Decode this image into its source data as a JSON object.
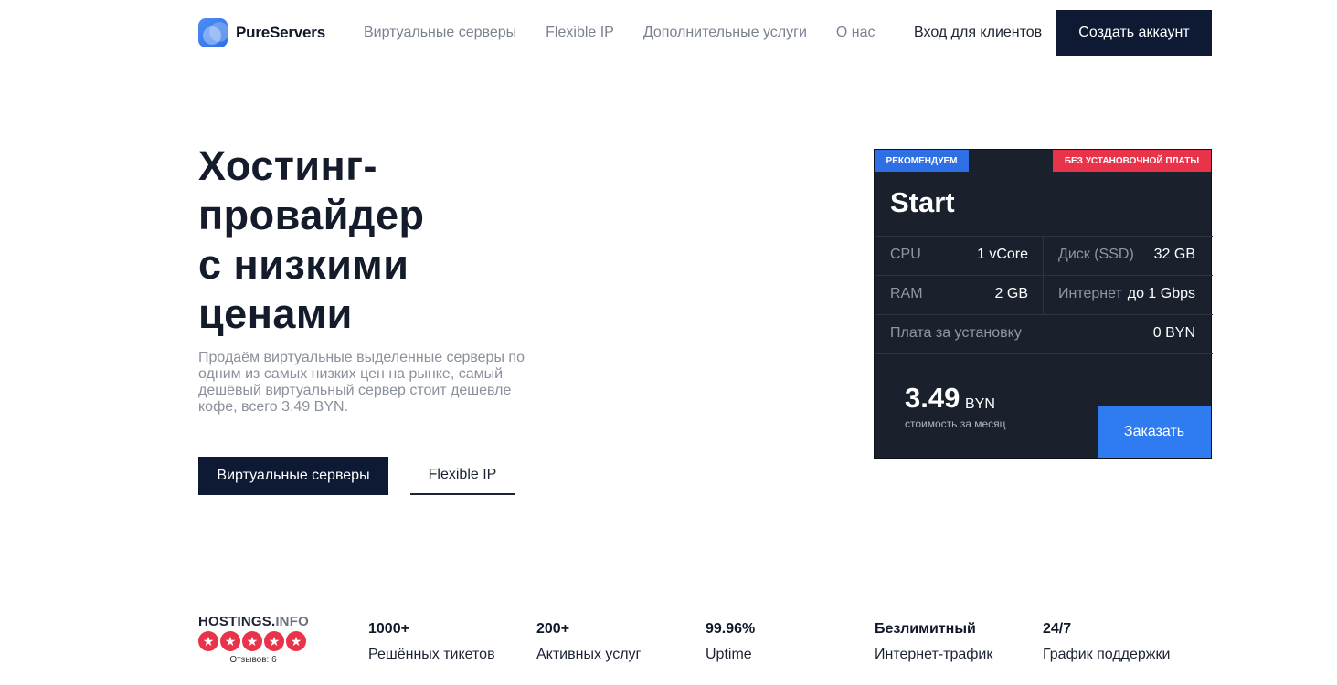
{
  "header": {
    "brand": "PureServers",
    "nav": [
      {
        "label": "Виртуальные серверы"
      },
      {
        "label": "Flexible IP"
      },
      {
        "label": "Дополнительные услуги"
      },
      {
        "label": "О нас"
      }
    ],
    "login_label": "Вход для клиентов",
    "signup_label": "Создать аккаунт"
  },
  "hero": {
    "title_lines": [
      "Хостинг-",
      "провайдер",
      "с низкими",
      "ценами"
    ],
    "description": "Продаём виртуальные выделенные серверы по одним из самых низких цен на рынке, самый дешёвый виртуальный сервер стоит дешевле кофе, всего 3.49 BYN.",
    "primary_button": "Виртуальные серверы",
    "secondary_button": "Flexible IP"
  },
  "plan_card": {
    "badge_recommended": "РЕКОМЕНДУЕМ",
    "badge_no_fee": "БЕЗ УСТАНОВОЧНОЙ ПЛАТЫ",
    "name": "Start",
    "specs": {
      "cpu_label": "CPU",
      "cpu_value": "1 vCore",
      "disk_label": "Диск (SSD)",
      "disk_value": "32 GB",
      "ram_label": "RAM",
      "ram_value": "2 GB",
      "internet_label": "Интернет",
      "internet_value": "до 1 Gbps",
      "setup_label": "Плата за установку",
      "setup_value": "0 BYN"
    },
    "price": "3.49",
    "currency": "BYN",
    "price_note": "стоимость за месяц",
    "order_button": "Заказать"
  },
  "rating": {
    "brand_main": "HOSTINGS.",
    "brand_suffix": "INFO",
    "stars": 5,
    "reviews": "Отзывов: 6"
  },
  "stats": [
    {
      "value": "1000+",
      "label": "Решённых тикетов"
    },
    {
      "value": "200+",
      "label": "Активных услуг"
    },
    {
      "value": "99.96%",
      "label": "Uptime"
    },
    {
      "value": "Безлимитный",
      "label": "Интернет-трафик"
    },
    {
      "value": "24/7",
      "label": "График поддержки"
    }
  ],
  "colors": {
    "navy": "#0e1a33",
    "card_bg": "#1a212d",
    "accent_blue": "#2f6fe6",
    "accent_red": "#e8334a"
  }
}
